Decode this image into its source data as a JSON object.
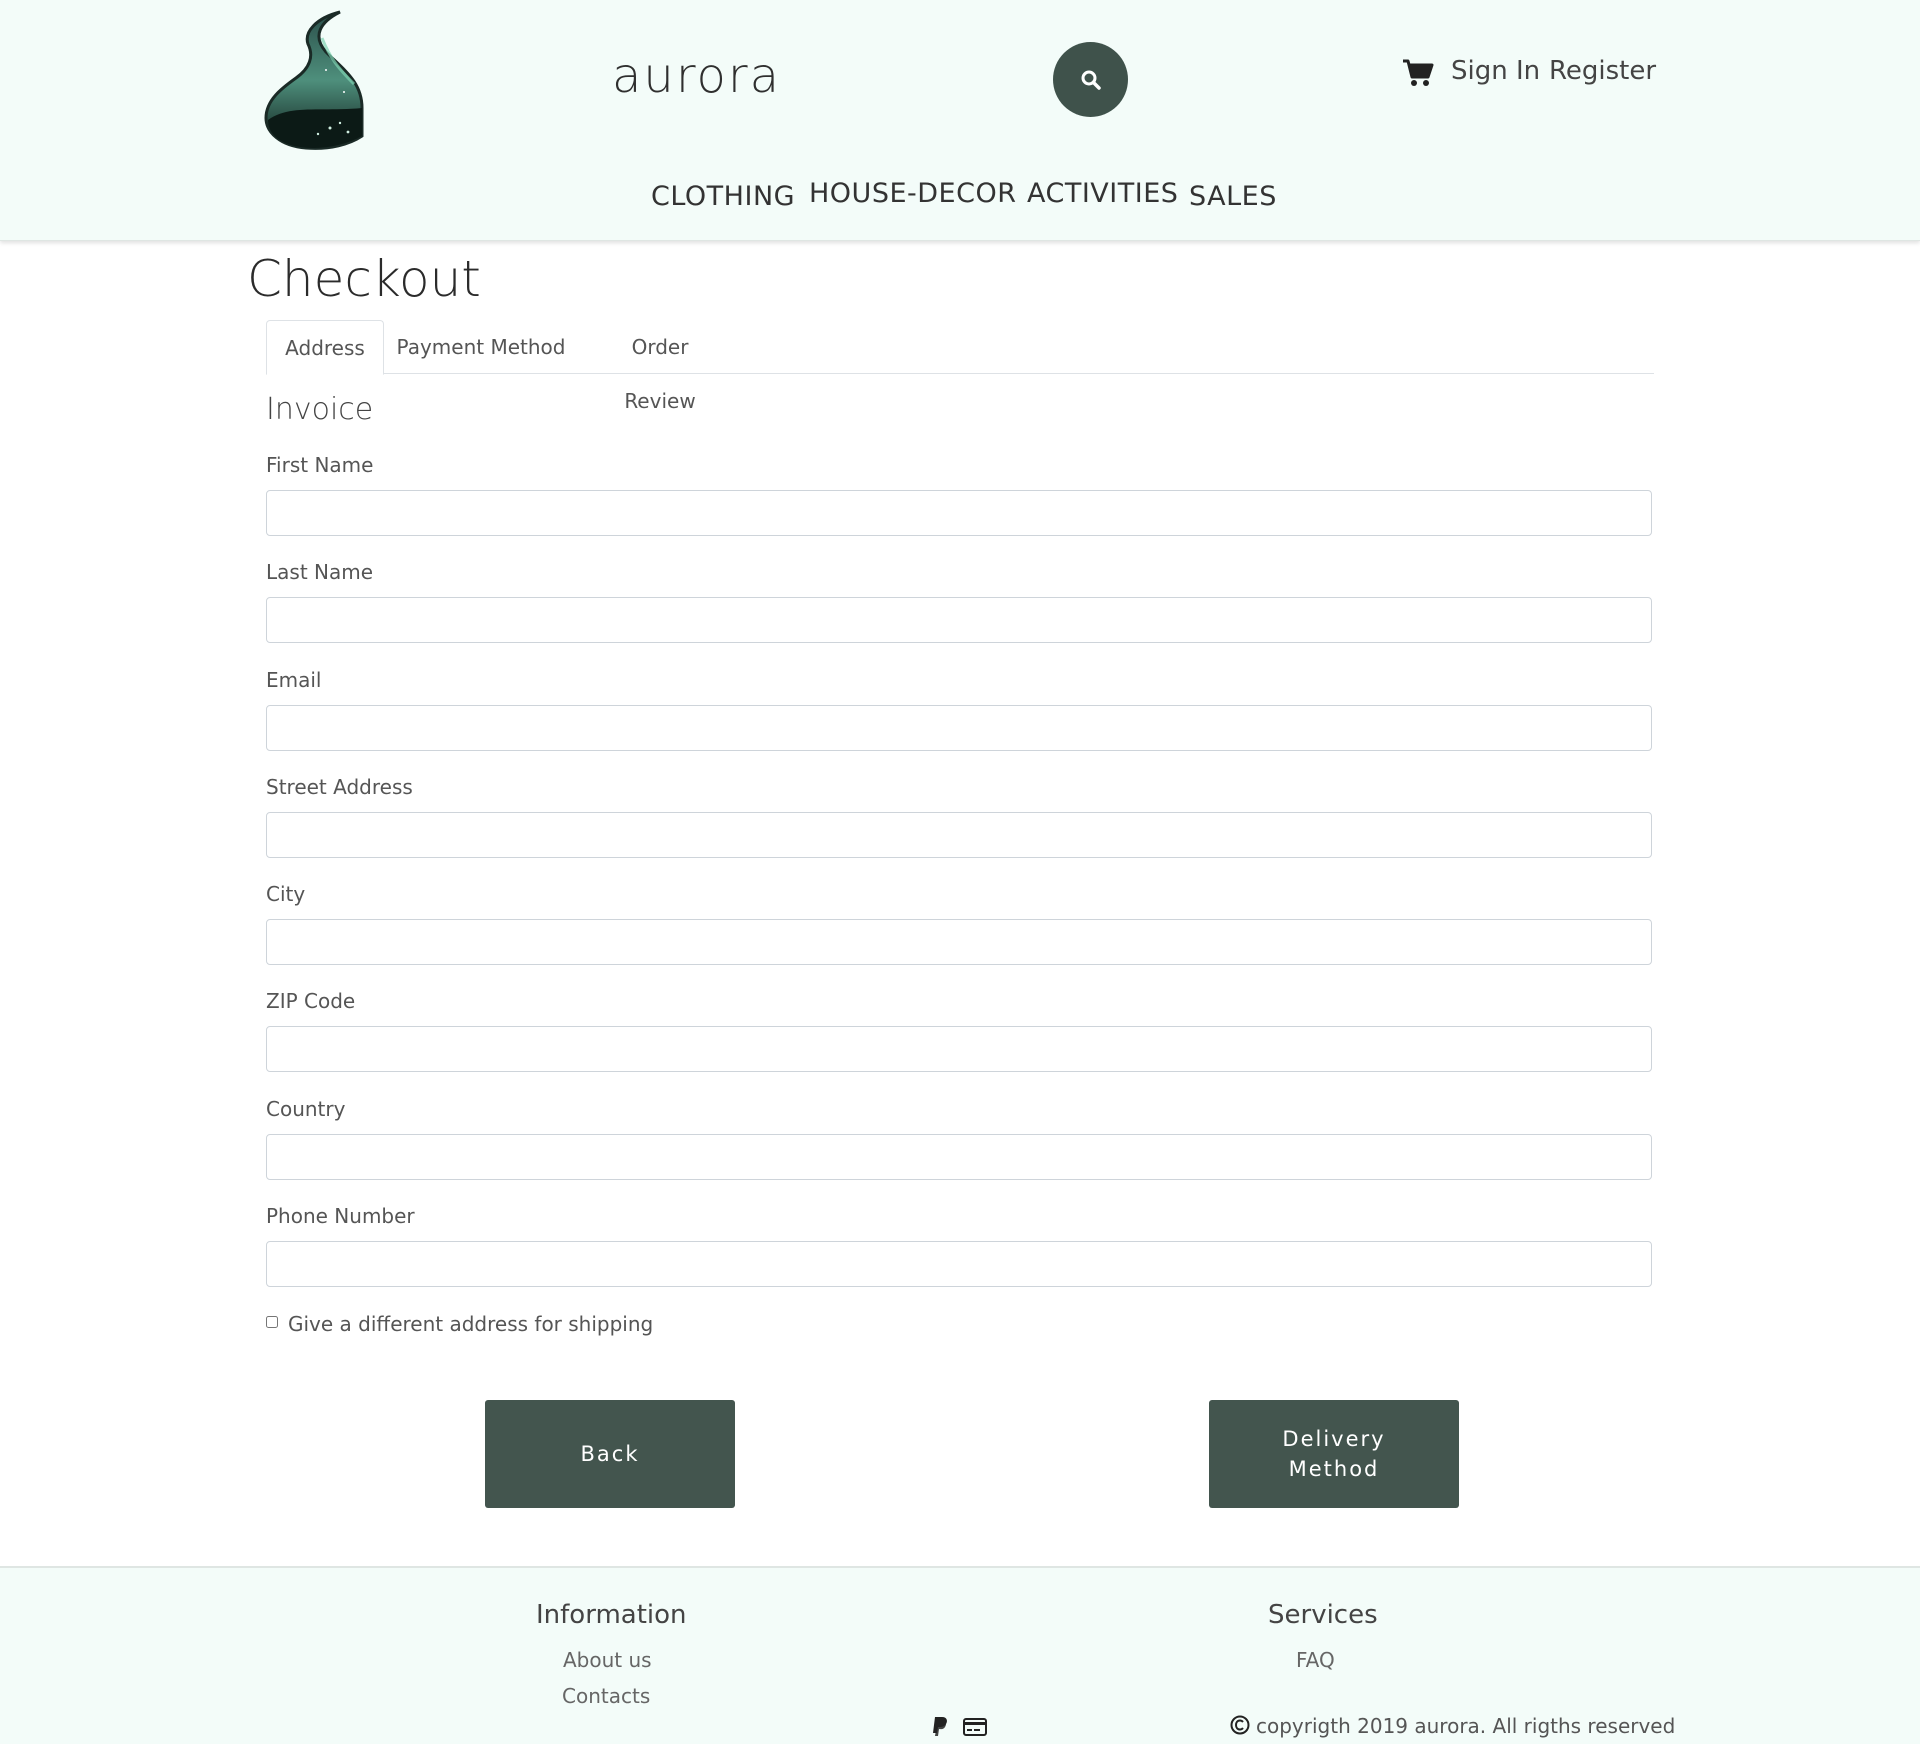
{
  "header": {
    "brand": "aurora",
    "signin_label": "Sign In",
    "register_label": "Register",
    "nav": [
      "CLOTHING",
      "HOUSE-DECOR",
      "ACTIVITIES",
      "SALES"
    ],
    "colors": {
      "background": "#f3fcf9",
      "accent": "#3f524b"
    }
  },
  "main": {
    "title": "Checkout",
    "tabs": [
      "Address",
      "Payment Method",
      "Order Review"
    ],
    "active_tab": "Address",
    "section_title": "Invoice",
    "fields": [
      {
        "label": "First Name",
        "value": ""
      },
      {
        "label": "Last Name",
        "value": ""
      },
      {
        "label": "Email",
        "value": ""
      },
      {
        "label": "Street Address",
        "value": ""
      },
      {
        "label": "City",
        "value": ""
      },
      {
        "label": "ZIP Code",
        "value": ""
      },
      {
        "label": "Country",
        "value": ""
      },
      {
        "label": "Phone Number",
        "value": ""
      }
    ],
    "shipping_checkbox_label": "Give a different address for shipping",
    "shipping_checkbox_checked": false,
    "back_label": "Back",
    "next_label": "Delivery Method"
  },
  "footer": {
    "information_title": "Information",
    "information_links": [
      "About us",
      "Contacts"
    ],
    "services_title": "Services",
    "services_links": [
      "FAQ"
    ],
    "payment_icons": [
      "paypal-icon",
      "credit-card-icon"
    ],
    "copyright": "copyrigth 2019 aurora. All rigths reserved"
  }
}
